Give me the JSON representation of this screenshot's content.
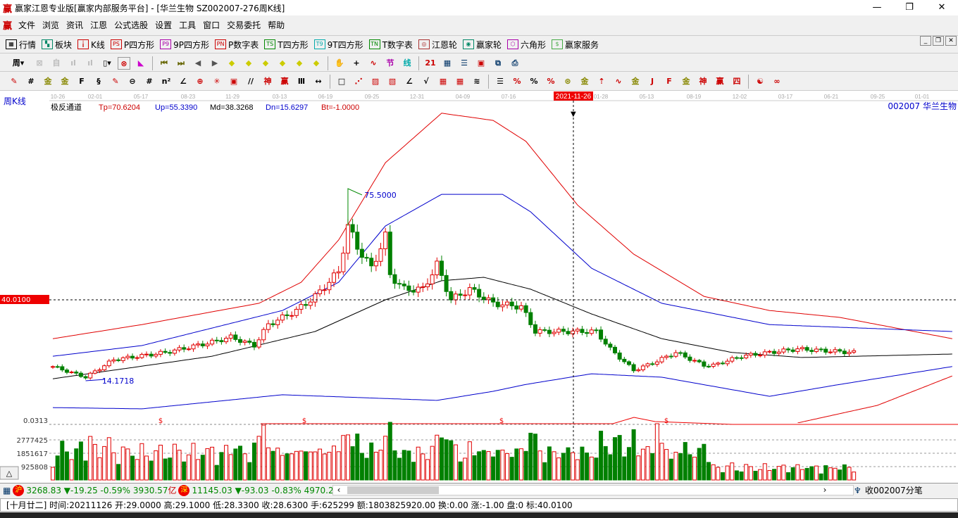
{
  "window": {
    "title": "赢家江恩专业版[赢家内部服务平台] - [华兰生物  SZ002007-276周K线]",
    "logo": "赢"
  },
  "menu": [
    "文件",
    "浏览",
    "资讯",
    "江恩",
    "公式选股",
    "设置",
    "工具",
    "窗口",
    "交易委托",
    "帮助"
  ],
  "toolbar1": [
    {
      "icon": "quotes-table-icon",
      "glyph": "▦",
      "label": "行情",
      "color": "#000"
    },
    {
      "icon": "sector-blocks-icon",
      "glyph": "▚",
      "label": "板块",
      "color": "#086"
    },
    {
      "icon": "kline-icon",
      "glyph": "╽",
      "label": "K线",
      "color": "#c00"
    },
    {
      "icon": "ps-icon",
      "glyph": "PS",
      "label": "P四方形",
      "color": "#c00"
    },
    {
      "icon": "p9-icon",
      "glyph": "P9",
      "label": "9P四方形",
      "color": "#a0a"
    },
    {
      "icon": "pn-icon",
      "glyph": "PN",
      "label": "P数字表",
      "color": "#c00"
    },
    {
      "icon": "ts-icon",
      "glyph": "TS",
      "label": "T四方形",
      "color": "#080"
    },
    {
      "icon": "t9-icon",
      "glyph": "T9",
      "label": "9T四方形",
      "color": "#0aa"
    },
    {
      "icon": "tn-icon",
      "glyph": "TN",
      "label": "T数字表",
      "color": "#080"
    },
    {
      "icon": "gann-wheel-icon",
      "glyph": "◎",
      "label": "江恩轮",
      "color": "#a33"
    },
    {
      "icon": "winner-wheel-icon",
      "glyph": "◉",
      "label": "赢家轮",
      "color": "#086"
    },
    {
      "icon": "hexagon-icon",
      "glyph": "⬡",
      "label": "六角形",
      "color": "#a0a"
    },
    {
      "icon": "dollar-icon",
      "glyph": "$",
      "label": "赢家服务",
      "color": "#4a4"
    }
  ],
  "period_label": "周",
  "axis": {
    "dates": [
      "10-26",
      "02-01",
      "05-17",
      "08-23",
      "11-29",
      "03-13",
      "06-19",
      "09-25",
      "12-31",
      "04-09",
      "07-16",
      "10-22",
      "01-28",
      "05-13",
      "08-19",
      "12-02",
      "03-17",
      "06-21",
      "09-25",
      "01-01"
    ],
    "cursor_date": "2021-11-26",
    "cursor_price": "40.0100",
    "period_title": "周K线",
    "stock": "002007  华兰生物"
  },
  "indicator": {
    "name": "极反通道",
    "tp": "Tp=70.6204",
    "up": "Up=55.3390",
    "md": "Md=38.3268",
    "dn": "Dn=15.6297",
    "bt": "Bt=-1.0000"
  },
  "annotations": {
    "high": "75.5000",
    "low": "14.1718"
  },
  "sub": {
    "value": "0.0313",
    "marker": "$"
  },
  "volume_axis": [
    "2777425",
    "1851617",
    "925808"
  ],
  "index_bar": {
    "sh": {
      "badge": "沪",
      "value": "3268.83",
      "change": "▼-19.25",
      "pct": "-0.59%",
      "amount": "3930.57",
      "unit": "亿"
    },
    "sz": {
      "badge": "深",
      "value": "11145.03",
      "change": "▼-93.03",
      "pct": "-0.83%",
      "amount": "4970.20"
    },
    "right": "收002007分笔"
  },
  "status": "[十月廿二] 时间:20211126 开:29.0000 高:29.1000 低:28.3300 收:28.6300 手:625299 额:1803825920.00 换:0.00 涨:-1.00 盘:0 标:40.0100",
  "colors": {
    "up": "#e00000",
    "down": "#008000",
    "tp": "#e00000",
    "up_line": "#0000cc",
    "md": "#000000",
    "dn": "#0000cc"
  },
  "chart_data": {
    "type": "candlestick",
    "title": "002007 华兰生物 周K线",
    "price_keypoints": {
      "week": [
        0,
        7,
        13,
        24,
        34,
        38,
        43,
        46,
        52,
        56,
        61,
        63,
        65,
        68,
        71,
        72,
        75,
        79,
        82,
        85,
        89,
        94,
        100,
        103,
        109,
        116,
        119,
        124,
        128,
        133,
        139,
        141,
        147,
        153,
        159,
        171
      ],
      "close": [
        18.7,
        15.3,
        20.9,
        23.2,
        26.5,
        28.1,
        25.4,
        32.1,
        36.6,
        41.1,
        49.0,
        63.6,
        56.9,
        50.1,
        60.2,
        47.9,
        43.4,
        43.4,
        51.2,
        40.0,
        43.4,
        38.9,
        37.8,
        29.9,
        29.9,
        29.9,
        24.3,
        17.5,
        19.8,
        23.2,
        19.1,
        19.1,
        22.0,
        23.2,
        24.3,
        23.2
      ]
    },
    "channels": [
      {
        "name": "Tp",
        "week": [
          0,
          19,
          44,
          53,
          61,
          71,
          83,
          94,
          101,
          112,
          124,
          139,
          153,
          168,
          192
        ],
        "value": [
          27.6,
          32.1,
          38.9,
          45.6,
          59.1,
          83.8,
          99.6,
          97.3,
          90.6,
          70.3,
          54.6,
          41.1,
          36.6,
          34.4,
          27.6
        ]
      },
      {
        "name": "Up",
        "week": [
          0,
          19,
          49,
          61,
          71,
          83,
          96,
          102,
          115,
          130,
          153,
          192
        ],
        "value": [
          22.0,
          25.4,
          36.6,
          45.6,
          63.6,
          73.7,
          73.7,
          68.1,
          50.1,
          38.9,
          32.1,
          29.9
        ]
      },
      {
        "name": "Md",
        "week": [
          0,
          34,
          56,
          71,
          83,
          92,
          102,
          115,
          130,
          145,
          160,
          192
        ],
        "value": [
          14.8,
          22.0,
          29.9,
          40.0,
          46.1,
          47.2,
          43.4,
          35.5,
          27.6,
          23.2,
          21.6,
          22.7
        ]
      },
      {
        "name": "Dn",
        "week": [
          0,
          19,
          49,
          71,
          82,
          94,
          101,
          115,
          130,
          153,
          168,
          192
        ],
        "value": [
          5.6,
          5.2,
          9.7,
          8.5,
          7.9,
          10.8,
          13.0,
          16.4,
          15.3,
          9.2,
          13.0,
          18.7
        ]
      },
      {
        "name": "Bt",
        "week": [
          159,
          176,
          192
        ],
        "value": [
          0.7,
          6.3,
          15.7
        ]
      }
    ],
    "ylim": [
      -5,
      100
    ]
  }
}
